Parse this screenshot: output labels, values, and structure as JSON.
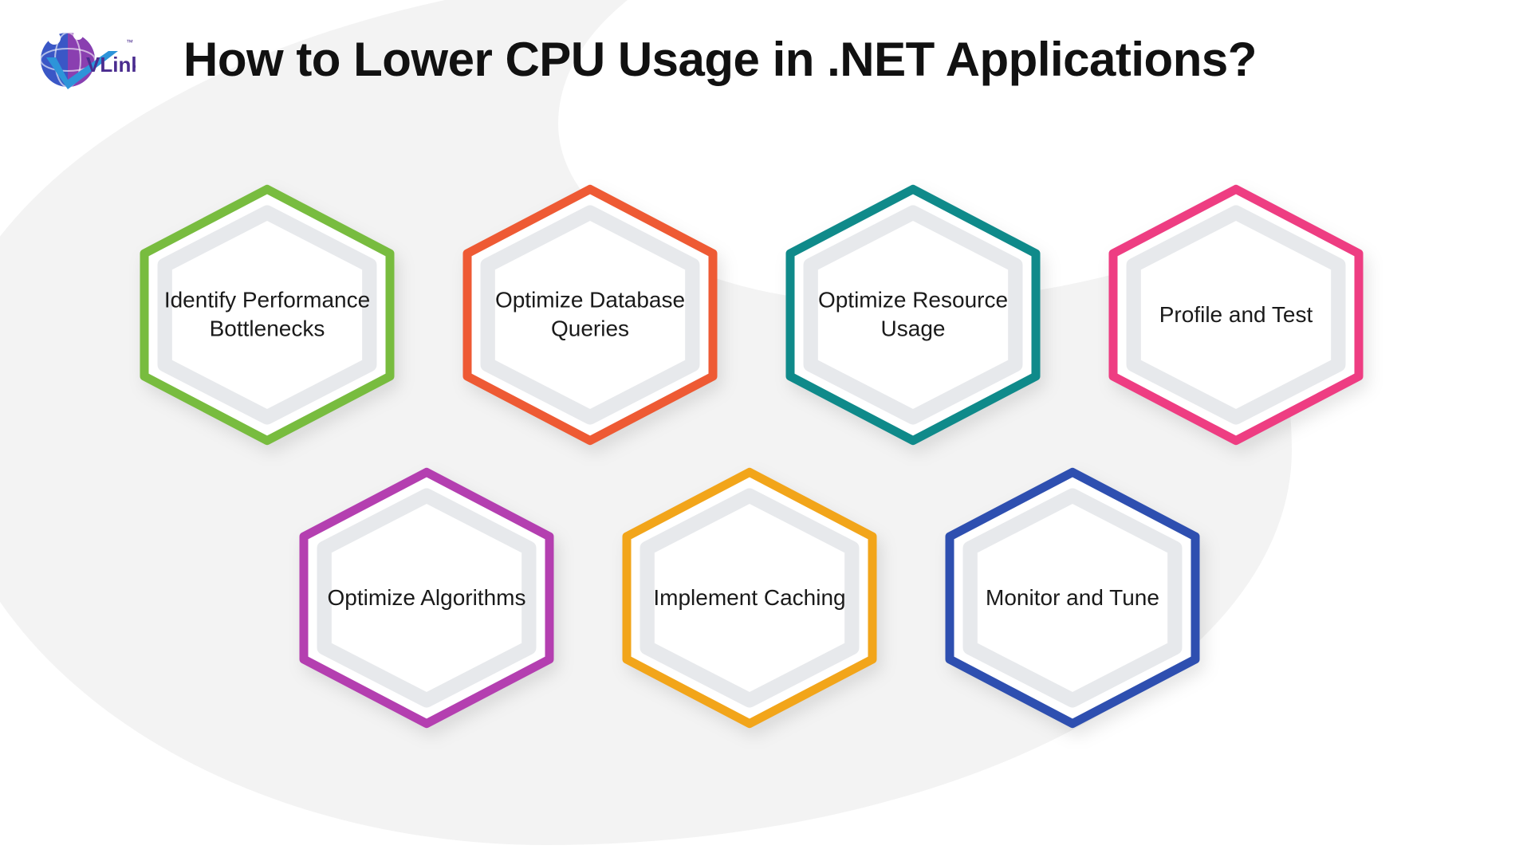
{
  "brand": {
    "name": "VLink"
  },
  "title": "How to Lower CPU Usage in .NET Applications?",
  "colors": {
    "green": "#78bc3f",
    "orange": "#ee5a34",
    "teal": "#0f8a8a",
    "pink": "#ee3d82",
    "purple": "#b43fb0",
    "amber": "#f2a51a",
    "blue": "#2e4fb0",
    "inner": "#eef0f2",
    "fill": "#ffffff"
  },
  "hexagons": [
    {
      "id": "identify-bottlenecks",
      "row": 1,
      "col": 1,
      "colorKey": "green",
      "label": "Identify Performance Bottlenecks"
    },
    {
      "id": "optimize-db",
      "row": 1,
      "col": 2,
      "colorKey": "orange",
      "label": "Optimize Database Queries"
    },
    {
      "id": "optimize-resource",
      "row": 1,
      "col": 3,
      "colorKey": "teal",
      "label": "Optimize Resource Usage"
    },
    {
      "id": "profile-test",
      "row": 1,
      "col": 4,
      "colorKey": "pink",
      "label": "Profile and Test"
    },
    {
      "id": "optimize-algorithms",
      "row": 2,
      "col": 1,
      "colorKey": "purple",
      "label": "Optimize Algorithms"
    },
    {
      "id": "implement-caching",
      "row": 2,
      "col": 2,
      "colorKey": "amber",
      "label": "Implement Caching"
    },
    {
      "id": "monitor-tune",
      "row": 2,
      "col": 3,
      "colorKey": "blue",
      "label": "Monitor and Tune"
    }
  ]
}
